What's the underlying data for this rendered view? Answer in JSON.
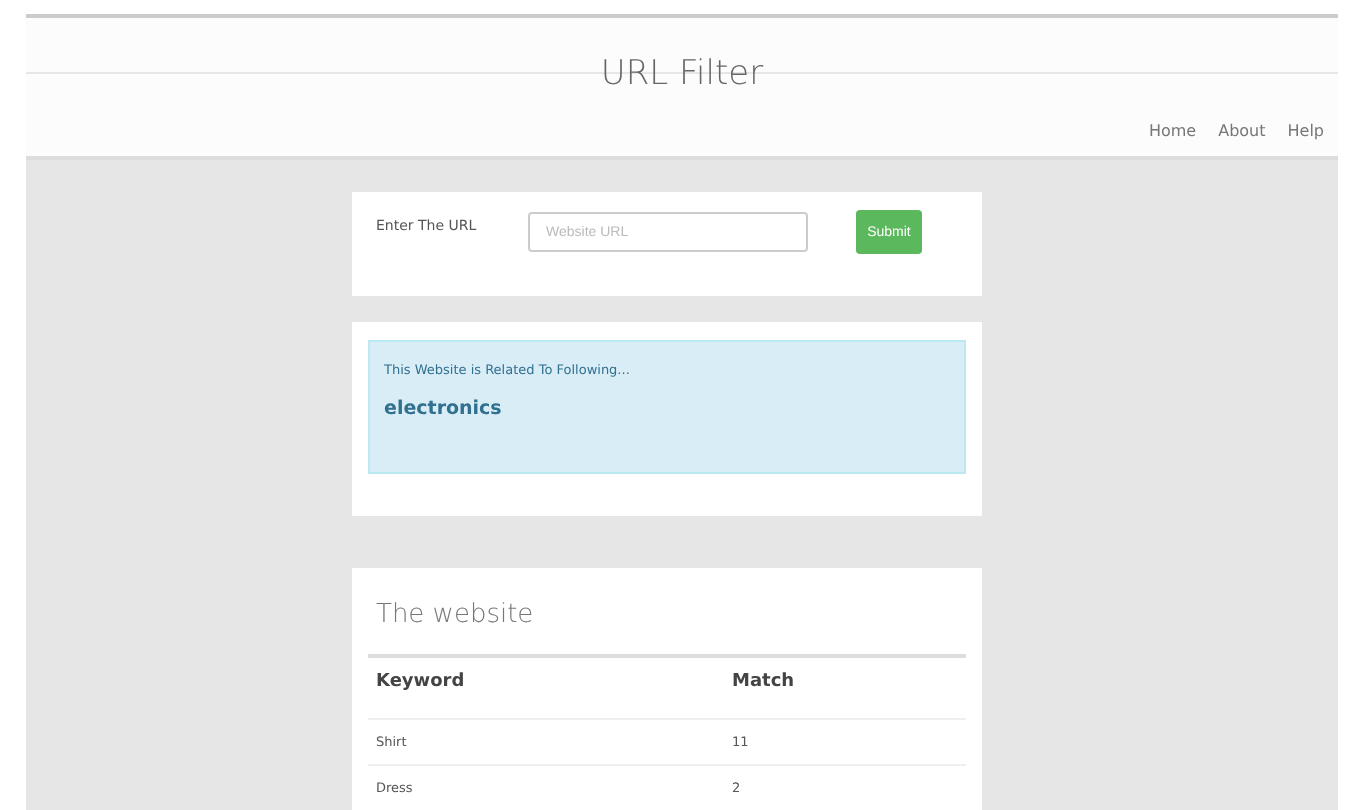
{
  "header": {
    "title": "URL Filter",
    "nav": [
      "Home",
      "About",
      "Help"
    ]
  },
  "url_form": {
    "label": "Enter The URL",
    "placeholder": "Website URL",
    "button": "Submit"
  },
  "result": {
    "message": "This Website is Related To Following...",
    "category": "electronics"
  },
  "table": {
    "title": "The website",
    "columns": [
      "Keyword",
      "Match"
    ],
    "rows": [
      [
        "Shirt",
        "11"
      ],
      [
        "Dress",
        "2"
      ]
    ]
  }
}
